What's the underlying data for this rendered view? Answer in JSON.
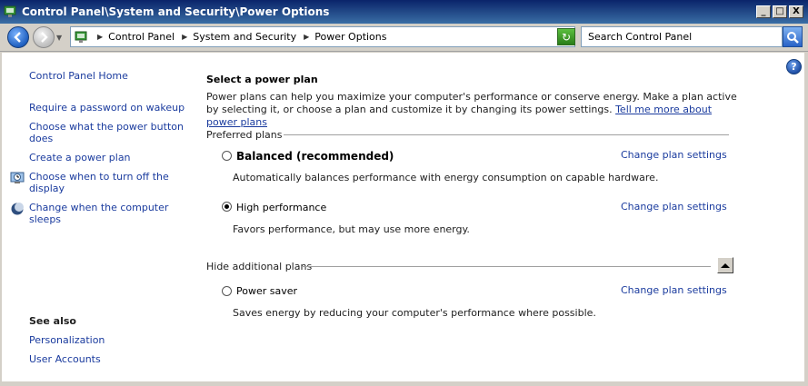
{
  "window": {
    "title": "Control Panel\\System and Security\\Power Options",
    "buttons": {
      "minimize": "_",
      "maximize": "□",
      "close": "X"
    }
  },
  "address": {
    "crumbs": [
      "Control Panel",
      "System and Security",
      "Power Options"
    ],
    "search_placeholder": "Search Control Panel"
  },
  "sidebar": {
    "home": "Control Panel Home",
    "items": [
      "Require a password on wakeup",
      "Choose what the power button does",
      "Create a power plan",
      "Choose when to turn off the display",
      "Change when the computer sleeps"
    ],
    "see_also_title": "See also",
    "see_also": [
      "Personalization",
      "User Accounts"
    ]
  },
  "main": {
    "heading": "Select a power plan",
    "intro": "Power plans can help you maximize your computer's performance or conserve energy. Make a plan active by selecting it, or choose a plan and customize it by changing its power settings.",
    "intro_link": "Tell me more about power plans",
    "preferred_header": "Preferred plans",
    "hide_header": "Hide additional plans",
    "change_label": "Change plan settings",
    "plans": [
      {
        "name": "Balanced (recommended)",
        "desc": "Automatically balances performance with energy consumption on capable hardware.",
        "selected": false
      },
      {
        "name": "High performance",
        "desc": "Favors performance, but may use more energy.",
        "selected": true
      },
      {
        "name": "Power saver",
        "desc": "Saves energy by reducing your computer's performance where possible.",
        "selected": false
      }
    ]
  },
  "colors": {
    "link": "#1a3b9e",
    "titlebar": "#0a246a",
    "chrome": "#d4d0c8"
  }
}
